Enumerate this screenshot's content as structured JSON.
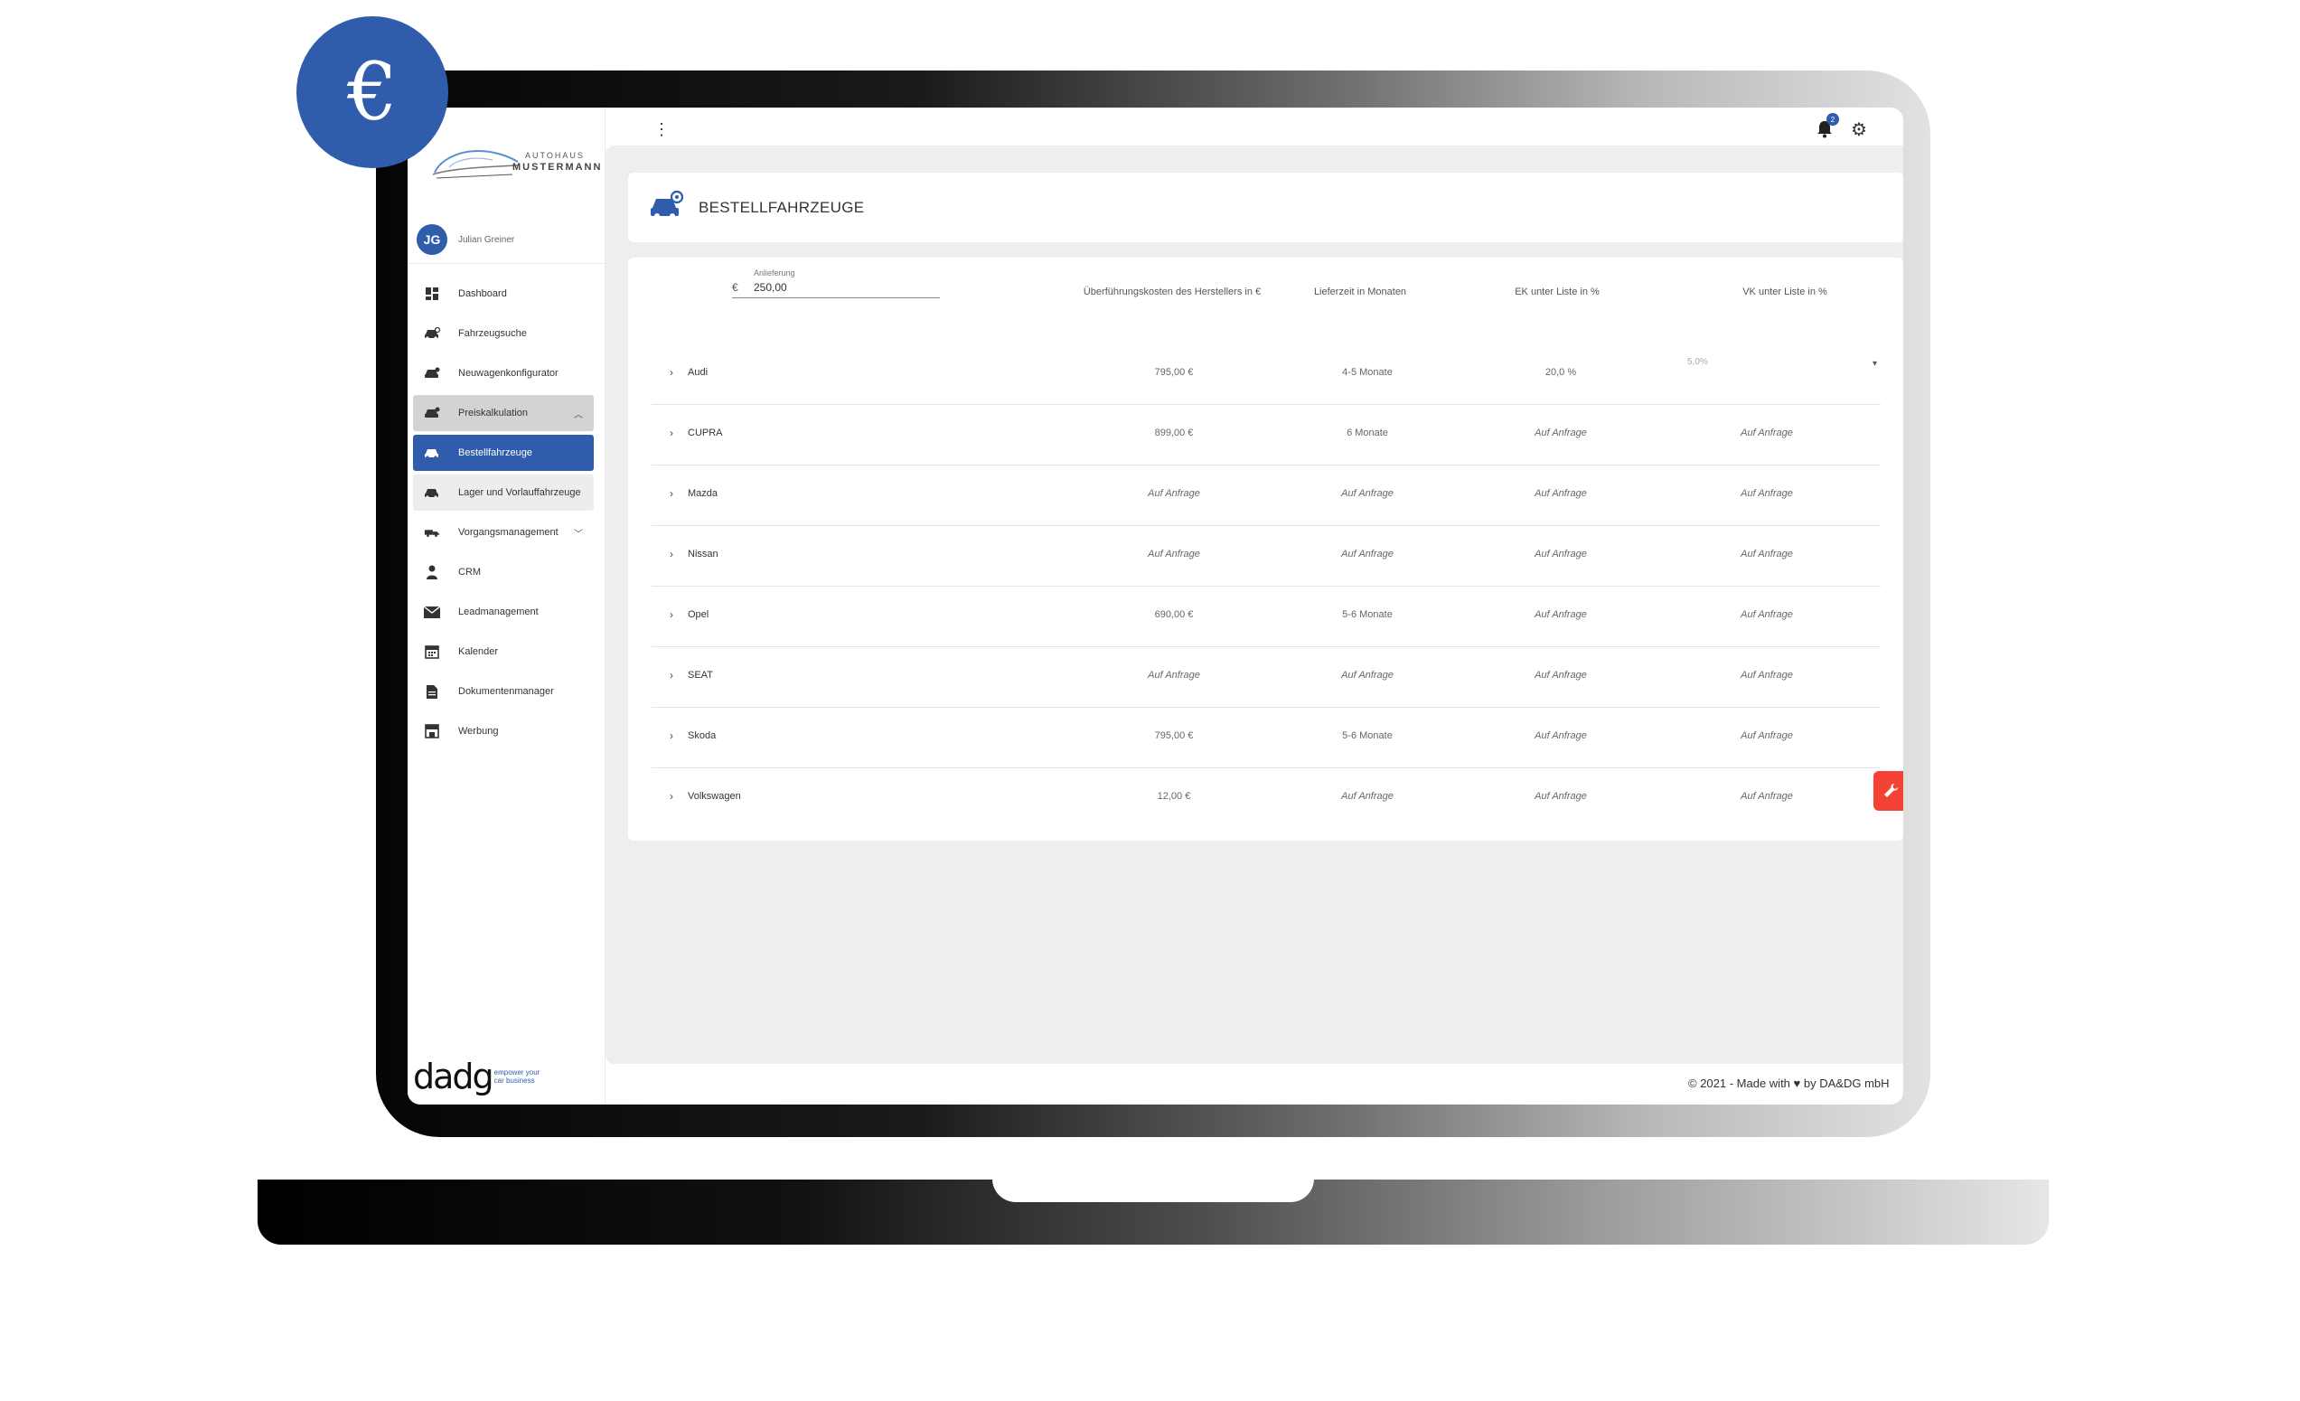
{
  "app": {
    "brand_top": "AUTOHAUS",
    "brand_bottom": "MUSTERMANN",
    "badge_symbol": "€",
    "accent_color": "#2f5dab",
    "fab_color": "#f44336"
  },
  "user": {
    "initials": "JG",
    "name": "Julian Greiner"
  },
  "sidebar": {
    "items": [
      {
        "label": "Dashboard",
        "icon": "dashboard-icon"
      },
      {
        "label": "Fahrzeugsuche",
        "icon": "car-search-icon"
      },
      {
        "label": "Neuwagenkonfigurator",
        "icon": "car-config-icon"
      },
      {
        "label": "Preiskalkulation",
        "icon": "car-price-icon",
        "expanded": true
      },
      {
        "label": "Bestellfahrzeuge",
        "icon": "car-icon",
        "active": true
      },
      {
        "label": "Lager und Vorlauffahrzeuge",
        "icon": "car-icon"
      },
      {
        "label": "Vorgangsmanagement",
        "icon": "truck-icon"
      },
      {
        "label": "CRM",
        "icon": "person-icon"
      },
      {
        "label": "Leadmanagement",
        "icon": "mail-icon"
      },
      {
        "label": "Kalender",
        "icon": "calendar-icon"
      },
      {
        "label": "Dokumentenmanager",
        "icon": "document-icon"
      },
      {
        "label": "Werbung",
        "icon": "store-icon"
      }
    ],
    "footer": {
      "logo_text": "dadg",
      "tagline_1": "empower your",
      "tagline_2": "car business"
    }
  },
  "topbar": {
    "menu_glyph": "⋮",
    "notifications_count": "2"
  },
  "page": {
    "title": "BESTELLFAHRZEUGE"
  },
  "filter": {
    "label": "Anlieferung",
    "currency": "€",
    "value": "250,00"
  },
  "table": {
    "columns": [
      "Überführungskosten des Herstellers in €",
      "Lieferzeit in Monaten",
      "EK unter Liste in %",
      "VK unter Liste in %"
    ],
    "vk_select_value": "5,0%",
    "rows": [
      {
        "brand": "Audi",
        "ueberfuehrung": "795,00 €",
        "lieferzeit": "4-5 Monate",
        "ek": "20,0 %",
        "vk": ""
      },
      {
        "brand": "CUPRA",
        "ueberfuehrung": "899,00 €",
        "lieferzeit": "6 Monate",
        "ek": "Auf Anfrage",
        "vk": "Auf Anfrage"
      },
      {
        "brand": "Mazda",
        "ueberfuehrung": "Auf Anfrage",
        "lieferzeit": "Auf Anfrage",
        "ek": "Auf Anfrage",
        "vk": "Auf Anfrage"
      },
      {
        "brand": "Nissan",
        "ueberfuehrung": "Auf Anfrage",
        "lieferzeit": "Auf Anfrage",
        "ek": "Auf Anfrage",
        "vk": "Auf Anfrage"
      },
      {
        "brand": "Opel",
        "ueberfuehrung": "690,00 €",
        "lieferzeit": "5-6 Monate",
        "ek": "Auf Anfrage",
        "vk": "Auf Anfrage"
      },
      {
        "brand": "SEAT",
        "ueberfuehrung": "Auf Anfrage",
        "lieferzeit": "Auf Anfrage",
        "ek": "Auf Anfrage",
        "vk": "Auf Anfrage"
      },
      {
        "brand": "Skoda",
        "ueberfuehrung": "795,00 €",
        "lieferzeit": "5-6 Monate",
        "ek": "Auf Anfrage",
        "vk": "Auf Anfrage"
      },
      {
        "brand": "Volkswagen",
        "ueberfuehrung": "12,00 €",
        "lieferzeit": "Auf Anfrage",
        "ek": "Auf Anfrage",
        "vk": "Auf Anfrage"
      }
    ]
  },
  "footer": {
    "copyright_pre": "© 2021 - Made with",
    "copyright_post": "by DA&DG mbH"
  }
}
